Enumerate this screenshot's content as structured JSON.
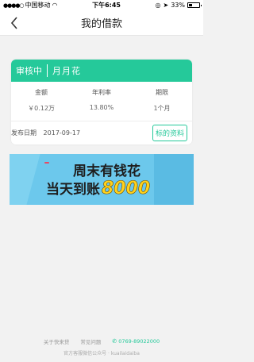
{
  "status_bar": {
    "carrier": "中国移动",
    "signal": "●●●●○",
    "time": "下午6:45",
    "battery": "33%"
  },
  "nav": {
    "title": "我的借款",
    "back_icon": "chevron-left-icon"
  },
  "loan": {
    "status": "审核中",
    "product": "月月花",
    "stats": [
      {
        "label": "金额",
        "value": "￥0.12万"
      },
      {
        "label": "年利率",
        "value": "13.80%"
      },
      {
        "label": "期限",
        "value": "1个月"
      }
    ],
    "publish_label": "发布日期",
    "publish_date": "2017-09-17",
    "docs_button": "标的资料"
  },
  "banner": {
    "tag": "",
    "line1": "周末有钱花",
    "line2": "当天到账",
    "amount": "8000"
  },
  "footer": {
    "links": [
      "关于快来贷",
      "常见问题"
    ],
    "phone": "0769-89022000",
    "wechat": "官方客服微信公众号 · kuailaidaiba"
  },
  "colors": {
    "accent": "#25c99a",
    "banner_bg": "#6cc8ec"
  }
}
